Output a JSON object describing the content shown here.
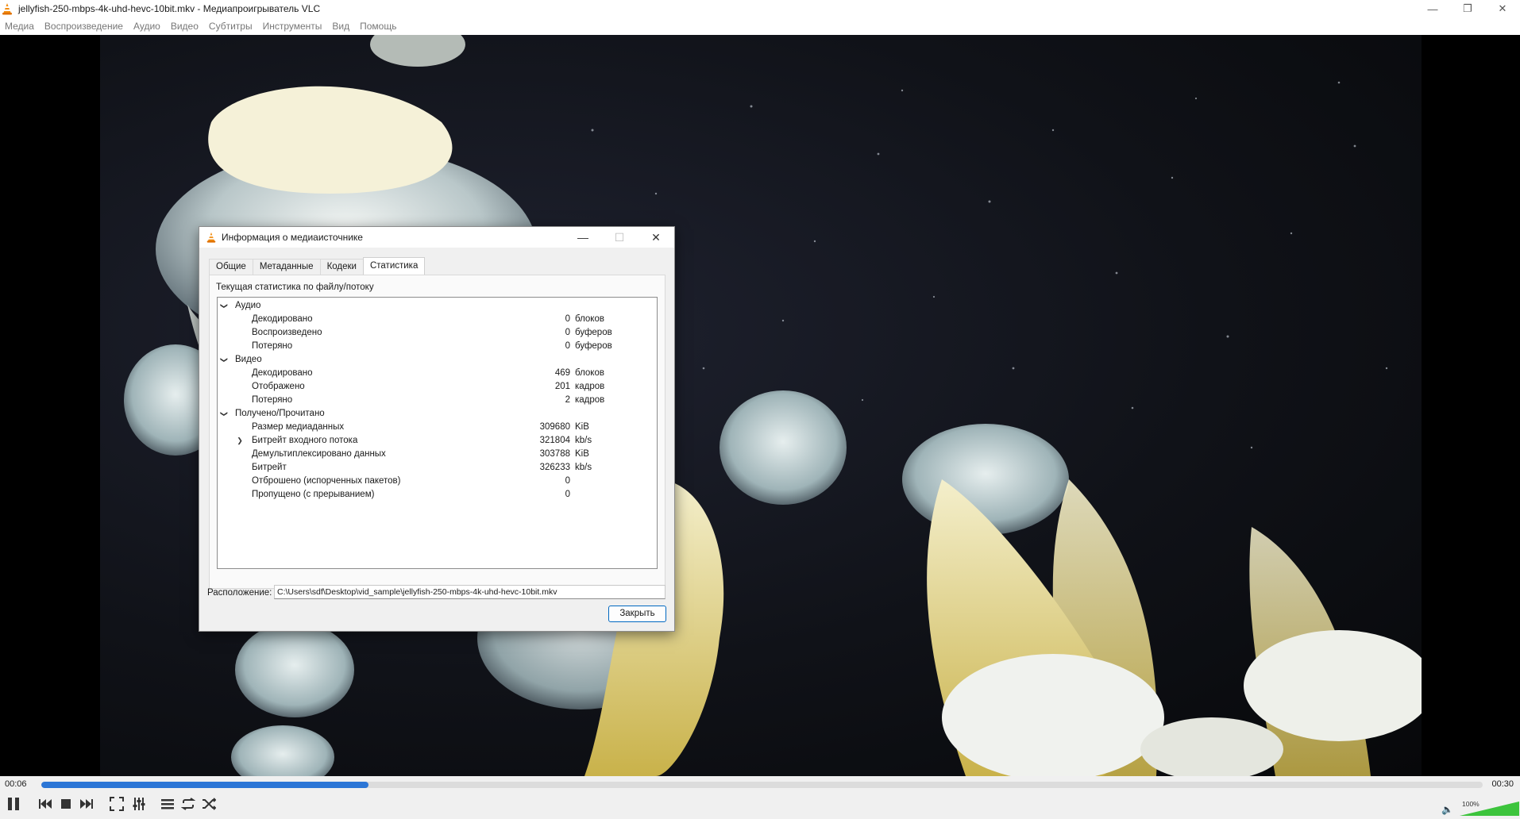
{
  "window": {
    "title": "jellyfish-250-mbps-4k-uhd-hevc-10bit.mkv - Медиапроигрыватель VLC",
    "controls": [
      "minimize-icon",
      "maximize-icon",
      "close-icon"
    ]
  },
  "menu": {
    "items": [
      "Медиа",
      "Воспроизведение",
      "Аудио",
      "Видео",
      "Субтитры",
      "Инструменты",
      "Вид",
      "Помощь"
    ]
  },
  "dialog": {
    "title": "Информация о медиаисточнике",
    "tabs": [
      "Общие",
      "Метаданные",
      "Кодеки",
      "Статистика"
    ],
    "active_tab": "Статистика",
    "heading": "Текущая статистика по файлу/потоку",
    "tree": [
      {
        "label": "Аудио",
        "level": 0,
        "expander": "expanded"
      },
      {
        "label": "Декодировано",
        "value": "0",
        "unit": "блоков",
        "level": 1
      },
      {
        "label": "Воспроизведено",
        "value": "0",
        "unit": "буферов",
        "level": 1
      },
      {
        "label": "Потеряно",
        "value": "0",
        "unit": "буферов",
        "level": 1
      },
      {
        "label": "Видео",
        "level": 0,
        "expander": "expanded"
      },
      {
        "label": "Декодировано",
        "value": "469",
        "unit": "блоков",
        "level": 1
      },
      {
        "label": "Отображено",
        "value": "201",
        "unit": "кадров",
        "level": 1
      },
      {
        "label": "Потеряно",
        "value": "2",
        "unit": "кадров",
        "level": 1
      },
      {
        "label": "Получено/Прочитано",
        "level": 0,
        "expander": "expanded"
      },
      {
        "label": "Размер медиаданных",
        "value": "309680",
        "unit": "KiB",
        "level": 1
      },
      {
        "label": "Битрейт входного потока",
        "value": "321804",
        "unit": "kb/s",
        "level": 1,
        "expander": "collapsed"
      },
      {
        "label": "Демультиплексировано данных",
        "value": "303788",
        "unit": "KiB",
        "level": 1
      },
      {
        "label": "Битрейт",
        "value": "326233",
        "unit": "kb/s",
        "level": 1
      },
      {
        "label": "Отброшено (испорченных пакетов)",
        "value": "0",
        "unit": "",
        "level": 1
      },
      {
        "label": "Пропущено (с прерыванием)",
        "value": "0",
        "unit": "",
        "level": 1
      }
    ],
    "location_label": "Расположение:",
    "location_value": "C:\\Users\\sdf\\Desktop\\vid_sample\\jellyfish-250-mbps-4k-uhd-hevc-10bit.mkv",
    "close_label": "Закрыть"
  },
  "player": {
    "elapsed": "00:06",
    "total": "00:30",
    "progress_fraction": 0.227,
    "volume": "100%",
    "volume_fraction": 1.0,
    "accent_color": "#2c76d6",
    "volume_color": "#3cc43c",
    "buttons": [
      "pause-icon",
      "previous-icon",
      "stop-icon",
      "next-icon",
      "fullscreen-icon",
      "extended-settings-icon",
      "playlist-icon",
      "loop-icon",
      "shuffle-icon"
    ]
  }
}
